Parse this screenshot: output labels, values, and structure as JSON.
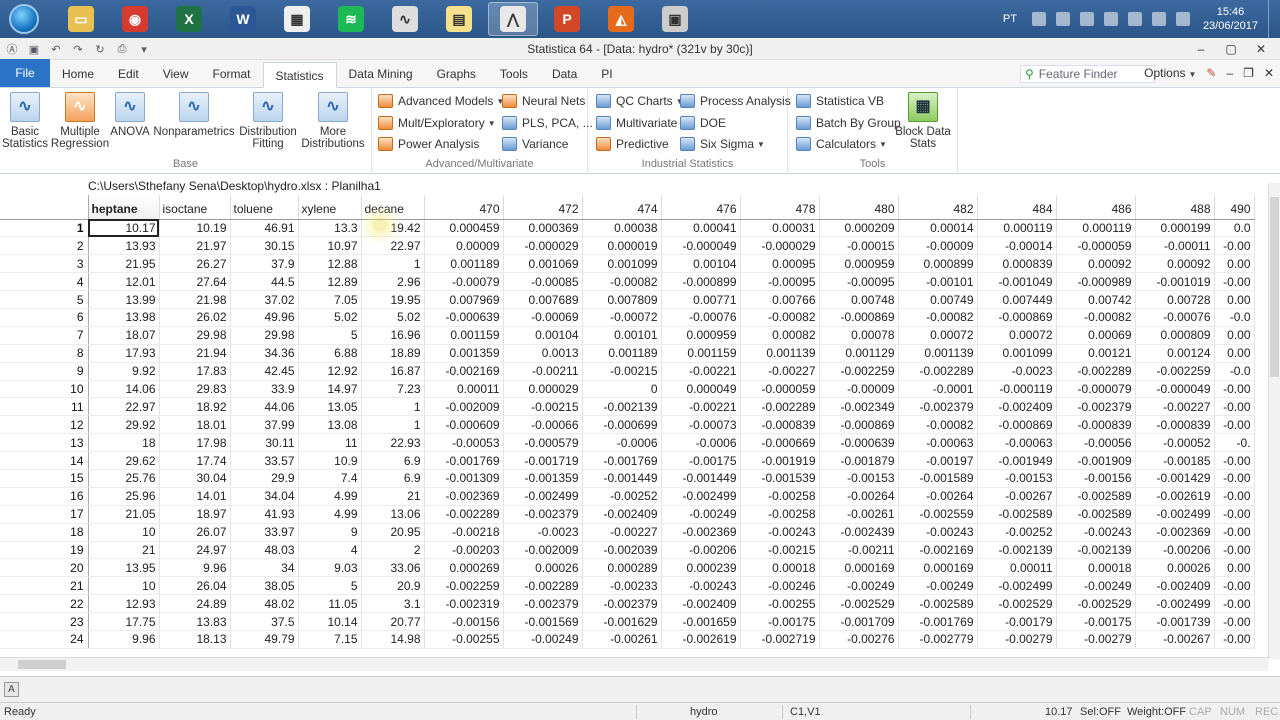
{
  "taskbar": {
    "apps": [
      {
        "name": "start",
        "icon": "windows-orb-icon"
      },
      {
        "name": "explorer",
        "icon": "folder-icon",
        "color": "#e8c052",
        "glyph": "▭"
      },
      {
        "name": "chrome",
        "icon": "chrome-icon",
        "color": "#d63b2f",
        "glyph": "◉"
      },
      {
        "name": "excel",
        "icon": "excel-icon",
        "color": "#1f7244",
        "glyph": "X"
      },
      {
        "name": "word",
        "icon": "word-icon",
        "color": "#2b5797",
        "glyph": "W"
      },
      {
        "name": "calculator",
        "icon": "calculator-icon",
        "color": "#eeeeee",
        "glyph": "▦"
      },
      {
        "name": "spotify",
        "icon": "spotify-icon",
        "color": "#1db954",
        "glyph": "≋"
      },
      {
        "name": "statsoft",
        "icon": "statsoft-icon",
        "color": "#dddddd",
        "glyph": "∿"
      },
      {
        "name": "notes",
        "icon": "sticky-notes-icon",
        "color": "#f6e08a",
        "glyph": "▤"
      },
      {
        "name": "statistica",
        "icon": "statistica-icon",
        "color": "#e8e8e8",
        "glyph": "⋀",
        "active": true
      },
      {
        "name": "powerpoint",
        "icon": "powerpoint-icon",
        "color": "#d24726",
        "glyph": "P"
      },
      {
        "name": "matlab",
        "icon": "matlab-icon",
        "color": "#e56a1a",
        "glyph": "◭"
      },
      {
        "name": "media",
        "icon": "media-player-icon",
        "color": "#cccccc",
        "glyph": "▣"
      }
    ],
    "tray": {
      "lang": "PT",
      "time": "15:46",
      "date": "23/06/2017"
    }
  },
  "window": {
    "title": "Statistica 64 - [Data: hydro* (321v by 30c)]"
  },
  "ribbon": {
    "tabs": [
      "File",
      "Home",
      "Edit",
      "View",
      "Format",
      "Statistics",
      "Data Mining",
      "Graphs",
      "Tools",
      "Data",
      "PI"
    ],
    "selected_tab": "Statistics",
    "feature_finder_placeholder": "Feature Finder",
    "options_label": "Options",
    "groups": {
      "base": {
        "label": "Base",
        "buttons": [
          {
            "label": "Basic\nStatistics",
            "icon": "basic-statistics-icon"
          },
          {
            "label": "Multiple\nRegression",
            "icon": "multiple-regression-icon"
          },
          {
            "label": "ANOVA",
            "icon": "anova-icon"
          },
          {
            "label": "Nonparametrics",
            "icon": "nonparametrics-icon"
          },
          {
            "label": "Distribution\nFitting",
            "icon": "distribution-fitting-icon"
          },
          {
            "label": "More\nDistributions",
            "icon": "more-distributions-icon"
          }
        ]
      },
      "advanced": {
        "label": "Advanced/Multivariate",
        "buttons": [
          "Advanced Models",
          "Mult/Exploratory",
          "Power Analysis",
          "Neural Nets",
          "PLS, PCA, ...",
          "Variance"
        ]
      },
      "industrial": {
        "label": "Industrial Statistics",
        "buttons": [
          "QC Charts",
          "Multivariate",
          "Predictive",
          "Process Analysis",
          "DOE",
          "Six Sigma"
        ]
      },
      "tools": {
        "label": "Tools",
        "buttons": [
          "Statistica VB",
          "Batch By Group",
          "Calculators",
          "Block Data\nStats"
        ]
      }
    }
  },
  "sheet": {
    "file_path": "C:\\Users\\Sthefany Sena\\Desktop\\hydro.xlsx : Planilha1",
    "columns": [
      "heptane",
      "isoctane",
      "toluene",
      "xylene",
      "decane",
      "470",
      "472",
      "474",
      "476",
      "478",
      "480",
      "482",
      "484",
      "486",
      "488",
      "490"
    ],
    "rows": [
      [
        "1",
        "10.17",
        "10.19",
        "46.91",
        "13.3",
        "19.42",
        "0.000459",
        "0.000369",
        "0.00038",
        "0.00041",
        "0.00031",
        "0.000209",
        "0.00014",
        "0.000119",
        "0.000119",
        "0.000199",
        "0.0"
      ],
      [
        "2",
        "13.93",
        "21.97",
        "30.15",
        "10.97",
        "22.97",
        "0.00009",
        "-0.000029",
        "0.000019",
        "-0.000049",
        "-0.000029",
        "-0.00015",
        "-0.00009",
        "-0.00014",
        "-0.000059",
        "-0.00011",
        "-0.00"
      ],
      [
        "3",
        "21.95",
        "26.27",
        "37.9",
        "12.88",
        "1",
        "0.001189",
        "0.001069",
        "0.001099",
        "0.00104",
        "0.00095",
        "0.000959",
        "0.000899",
        "0.000839",
        "0.00092",
        "0.00092",
        "0.00"
      ],
      [
        "4",
        "12.01",
        "27.64",
        "44.5",
        "12.89",
        "2.96",
        "-0.00079",
        "-0.00085",
        "-0.00082",
        "-0.000899",
        "-0.00095",
        "-0.00095",
        "-0.00101",
        "-0.001049",
        "-0.000989",
        "-0.001019",
        "-0.00"
      ],
      [
        "5",
        "13.99",
        "21.98",
        "37.02",
        "7.05",
        "19.95",
        "0.007969",
        "0.007689",
        "0.007809",
        "0.00771",
        "0.00766",
        "0.00748",
        "0.00749",
        "0.007449",
        "0.00742",
        "0.00728",
        "0.00"
      ],
      [
        "6",
        "13.98",
        "26.02",
        "49.96",
        "5.02",
        "5.02",
        "-0.000639",
        "-0.00069",
        "-0.00072",
        "-0.00076",
        "-0.00082",
        "-0.000869",
        "-0.00082",
        "-0.000869",
        "-0.00082",
        "-0.00076",
        "-0.0"
      ],
      [
        "7",
        "18.07",
        "29.98",
        "29.98",
        "5",
        "16.96",
        "0.001159",
        "0.00104",
        "0.00101",
        "0.000959",
        "0.00082",
        "0.00078",
        "0.00072",
        "0.00072",
        "0.00069",
        "0.000809",
        "0.00"
      ],
      [
        "8",
        "17.93",
        "21.94",
        "34.36",
        "6.88",
        "18.89",
        "0.001359",
        "0.0013",
        "0.001189",
        "0.001159",
        "0.001139",
        "0.001129",
        "0.001139",
        "0.001099",
        "0.00121",
        "0.00124",
        "0.00"
      ],
      [
        "9",
        "9.92",
        "17.83",
        "42.45",
        "12.92",
        "16.87",
        "-0.002169",
        "-0.00211",
        "-0.00215",
        "-0.00221",
        "-0.00227",
        "-0.002259",
        "-0.002289",
        "-0.0023",
        "-0.002289",
        "-0.002259",
        "-0.0"
      ],
      [
        "10",
        "14.06",
        "29.83",
        "33.9",
        "14.97",
        "7.23",
        "0.00011",
        "0.000029",
        "0",
        "0.000049",
        "-0.000059",
        "-0.00009",
        "-0.0001",
        "-0.000119",
        "-0.000079",
        "-0.000049",
        "-0.00"
      ],
      [
        "11",
        "22.97",
        "18.92",
        "44.06",
        "13.05",
        "1",
        "-0.002009",
        "-0.00215",
        "-0.002139",
        "-0.00221",
        "-0.002289",
        "-0.002349",
        "-0.002379",
        "-0.002409",
        "-0.002379",
        "-0.00227",
        "-0.00"
      ],
      [
        "12",
        "29.92",
        "18.01",
        "37.99",
        "13.08",
        "1",
        "-0.000609",
        "-0.00066",
        "-0.000699",
        "-0.00073",
        "-0.000839",
        "-0.000869",
        "-0.00082",
        "-0.000869",
        "-0.000839",
        "-0.000839",
        "-0.00"
      ],
      [
        "13",
        "18",
        "17.98",
        "30.11",
        "11",
        "22.93",
        "-0.00053",
        "-0.000579",
        "-0.0006",
        "-0.0006",
        "-0.000669",
        "-0.000639",
        "-0.00063",
        "-0.00063",
        "-0.00056",
        "-0.00052",
        "-0."
      ],
      [
        "14",
        "29.62",
        "17.74",
        "33.57",
        "10.9",
        "6.9",
        "-0.001769",
        "-0.001719",
        "-0.001769",
        "-0.00175",
        "-0.001919",
        "-0.001879",
        "-0.00197",
        "-0.001949",
        "-0.001909",
        "-0.00185",
        "-0.00"
      ],
      [
        "15",
        "25.76",
        "30.04",
        "29.9",
        "7.4",
        "6.9",
        "-0.001309",
        "-0.001359",
        "-0.001449",
        "-0.001449",
        "-0.001539",
        "-0.00153",
        "-0.001589",
        "-0.00153",
        "-0.00156",
        "-0.001429",
        "-0.00"
      ],
      [
        "16",
        "25.96",
        "14.01",
        "34.04",
        "4.99",
        "21",
        "-0.002369",
        "-0.002499",
        "-0.00252",
        "-0.002499",
        "-0.00258",
        "-0.00264",
        "-0.00264",
        "-0.00267",
        "-0.002589",
        "-0.002619",
        "-0.00"
      ],
      [
        "17",
        "21.05",
        "18.97",
        "41.93",
        "4.99",
        "13.06",
        "-0.002289",
        "-0.002379",
        "-0.002409",
        "-0.00249",
        "-0.00258",
        "-0.00261",
        "-0.002559",
        "-0.002589",
        "-0.002589",
        "-0.002499",
        "-0.00"
      ],
      [
        "18",
        "10",
        "26.07",
        "33.97",
        "9",
        "20.95",
        "-0.00218",
        "-0.0023",
        "-0.00227",
        "-0.002369",
        "-0.00243",
        "-0.002439",
        "-0.00243",
        "-0.00252",
        "-0.00243",
        "-0.002369",
        "-0.00"
      ],
      [
        "19",
        "21",
        "24.97",
        "48.03",
        "4",
        "2",
        "-0.00203",
        "-0.002009",
        "-0.002039",
        "-0.00206",
        "-0.00215",
        "-0.00211",
        "-0.002169",
        "-0.002139",
        "-0.002139",
        "-0.00206",
        "-0.00"
      ],
      [
        "20",
        "13.95",
        "9.96",
        "34",
        "9.03",
        "33.06",
        "0.000269",
        "0.00026",
        "0.000289",
        "0.000239",
        "0.00018",
        "0.000169",
        "0.000169",
        "0.00011",
        "0.00018",
        "0.00026",
        "0.00"
      ],
      [
        "21",
        "10",
        "26.04",
        "38.05",
        "5",
        "20.9",
        "-0.002259",
        "-0.002289",
        "-0.00233",
        "-0.00243",
        "-0.00246",
        "-0.00249",
        "-0.00249",
        "-0.002499",
        "-0.00249",
        "-0.002409",
        "-0.00"
      ],
      [
        "22",
        "12.93",
        "24.89",
        "48.02",
        "11.05",
        "3.1",
        "-0.002319",
        "-0.002379",
        "-0.002379",
        "-0.002409",
        "-0.00255",
        "-0.002529",
        "-0.002589",
        "-0.002529",
        "-0.002529",
        "-0.002499",
        "-0.00"
      ],
      [
        "23",
        "17.75",
        "13.83",
        "37.5",
        "10.14",
        "20.77",
        "-0.00156",
        "-0.001569",
        "-0.001629",
        "-0.001659",
        "-0.00175",
        "-0.001709",
        "-0.001769",
        "-0.00179",
        "-0.00175",
        "-0.001739",
        "-0.00"
      ],
      [
        "24",
        "9.96",
        "18.13",
        "49.79",
        "7.15",
        "14.98",
        "-0.00255",
        "-0.00249",
        "-0.00261",
        "-0.002619",
        "-0.002719",
        "-0.00276",
        "-0.002779",
        "-0.00279",
        "-0.00279",
        "-0.00267",
        "-0.00"
      ]
    ]
  },
  "statusbar": {
    "left": "Ready",
    "sheet_name": "hydro",
    "cell_ref": "C1,V1",
    "cell_value": "10.17",
    "sel": "Sel:OFF",
    "weight": "Weight:OFF",
    "caps": "CAP",
    "num": "NUM",
    "rec": "REC"
  }
}
